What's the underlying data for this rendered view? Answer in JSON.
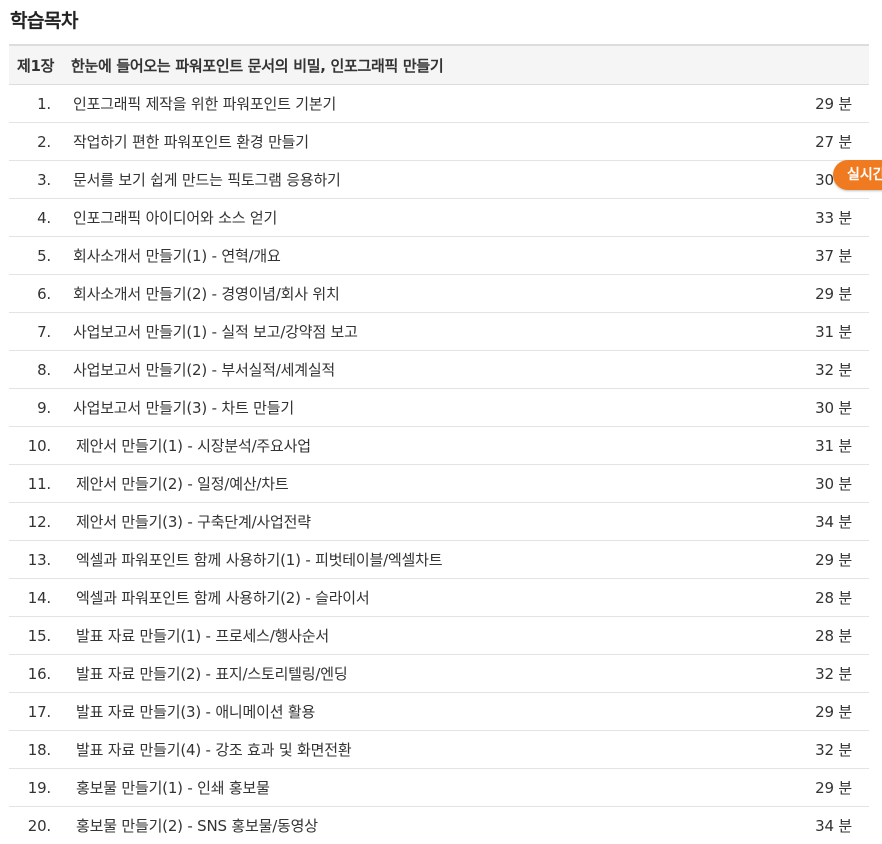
{
  "page_title": "학습목차",
  "chapter": {
    "number": "제1장",
    "title": "한눈에 들어오는 파워포인트 문서의 비밀, 인포그래픽 만들기"
  },
  "live_badge": "실시간",
  "lessons": [
    {
      "num": "1.",
      "title": "인포그래픽 제작을 위한 파워포인트 기본기",
      "duration": "29 분"
    },
    {
      "num": "2.",
      "title": "작업하기 편한 파워포인트 환경 만들기",
      "duration": "27 분"
    },
    {
      "num": "3.",
      "title": "문서를 보기 쉽게 만드는 픽토그램 응용하기",
      "duration": "30 분"
    },
    {
      "num": "4.",
      "title": "인포그래픽 아이디어와 소스 얻기",
      "duration": "33 분"
    },
    {
      "num": "5.",
      "title": "회사소개서 만들기(1) - 연혁/개요",
      "duration": "37 분"
    },
    {
      "num": "6.",
      "title": "회사소개서 만들기(2) - 경영이념/회사 위치",
      "duration": "29 분"
    },
    {
      "num": "7.",
      "title": "사업보고서 만들기(1) - 실적 보고/강약점 보고",
      "duration": "31 분"
    },
    {
      "num": "8.",
      "title": "사업보고서 만들기(2) - 부서실적/세계실적",
      "duration": "32 분"
    },
    {
      "num": "9.",
      "title": "사업보고서 만들기(3) - 차트 만들기",
      "duration": "30 분"
    },
    {
      "num": "10.",
      "title": "제안서 만들기(1) - 시장분석/주요사업",
      "duration": "31 분"
    },
    {
      "num": "11.",
      "title": "제안서 만들기(2) - 일정/예산/차트",
      "duration": "30 분"
    },
    {
      "num": "12.",
      "title": "제안서 만들기(3) - 구축단계/사업전략",
      "duration": "34 분"
    },
    {
      "num": "13.",
      "title": "엑셀과 파워포인트 함께 사용하기(1) - 피벗테이블/엑셀차트",
      "duration": "29 분"
    },
    {
      "num": "14.",
      "title": "엑셀과 파워포인트 함께 사용하기(2) - 슬라이서",
      "duration": "28 분"
    },
    {
      "num": "15.",
      "title": "발표 자료 만들기(1) - 프로세스/행사순서",
      "duration": "28 분"
    },
    {
      "num": "16.",
      "title": "발표 자료 만들기(2) - 표지/스토리텔링/엔딩",
      "duration": "32 분"
    },
    {
      "num": "17.",
      "title": "발표 자료 만들기(3) - 애니메이션 활용",
      "duration": "29 분"
    },
    {
      "num": "18.",
      "title": "발표 자료 만들기(4) - 강조 효과 및 화면전환",
      "duration": "32 분"
    },
    {
      "num": "19.",
      "title": "홍보물 만들기(1) - 인쇄 홍보물",
      "duration": "29 분"
    },
    {
      "num": "20.",
      "title": "홍보물 만들기(2) - SNS 홍보물/동영상",
      "duration": "34 분"
    }
  ]
}
